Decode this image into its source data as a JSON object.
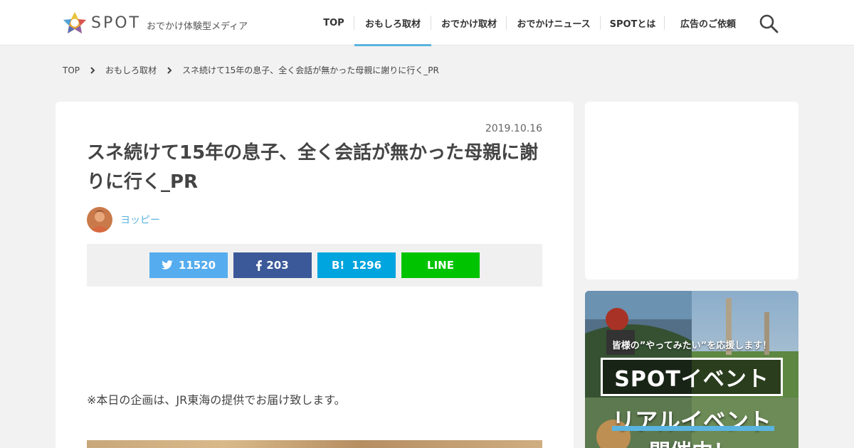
{
  "header": {
    "logo_text": "SPOT",
    "logo_tagline": "おでかけ体験型メディア",
    "nav": [
      {
        "label": "TOP",
        "active": false
      },
      {
        "label": "おもしろ取材",
        "active": true
      },
      {
        "label": "おでかけ取材",
        "active": false
      },
      {
        "label": "おでかけニュース",
        "active": false
      },
      {
        "label": "SPOTとは",
        "active": false
      },
      {
        "label": "広告のご依頼",
        "active": false
      }
    ],
    "search_icon": "search-icon",
    "accent_color": "#5ab4e0"
  },
  "breadcrumb": [
    "TOP",
    "おもしろ取材",
    "スネ続けて15年の息子、全く会話が無かった母親に謝りに行く_PR"
  ],
  "article": {
    "date": "2019.10.16",
    "title": "スネ続けて15年の息子、全く会話が無かった母親に謝りに行く_PR",
    "author": "ヨッピー",
    "intro": "※本日の企画は、JR東海の提供でお届け致します。"
  },
  "share": {
    "twitter": {
      "label": "11520",
      "color": "#55acee",
      "icon": "twitter-bird-icon"
    },
    "facebook": {
      "label": "203",
      "color": "#3b5998",
      "icon": "facebook-f-icon"
    },
    "hatena": {
      "label": "1296",
      "icon_text": "B!",
      "color": "#00a4de"
    },
    "line": {
      "label": "LINE",
      "color": "#00c300"
    }
  },
  "sidebar": {
    "banner": {
      "tagline": "皆様の”やってみたい”を応援します！",
      "title": "SPOTイベント",
      "subtitle": "リアルイベント",
      "subtitle2": "開催中！"
    }
  }
}
